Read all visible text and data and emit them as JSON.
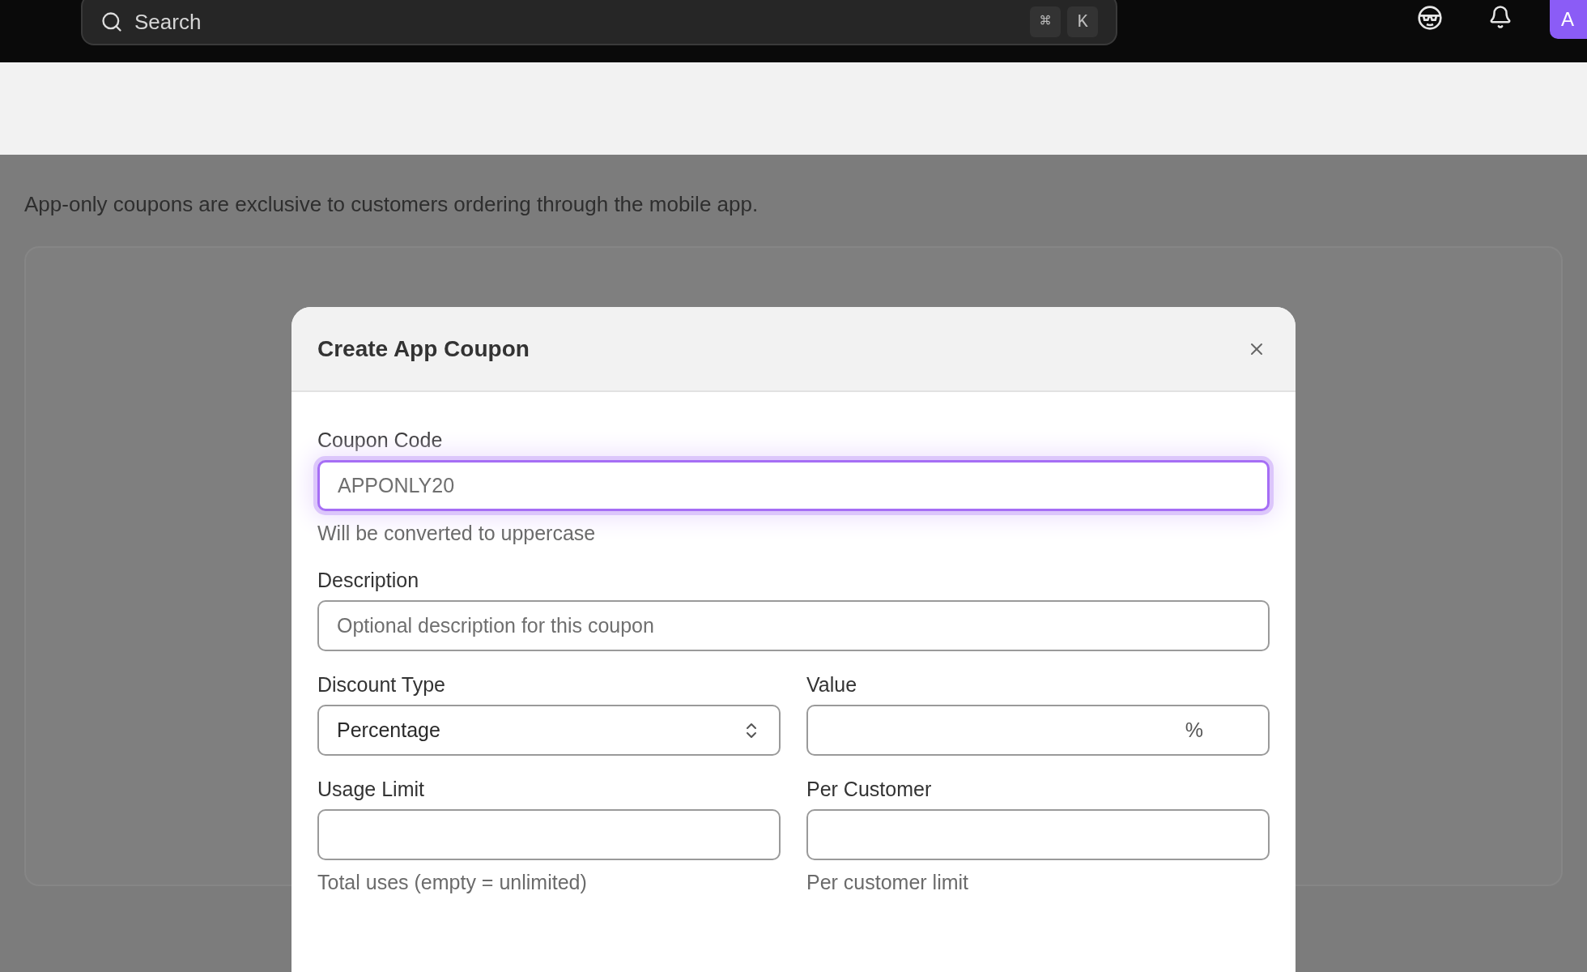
{
  "topbar": {
    "search": {
      "placeholder": "Search",
      "shortcut": [
        "⌘",
        "K"
      ]
    },
    "avatar": "A"
  },
  "page": {
    "description": "App-only coupons are exclusive to customers ordering through the mobile app."
  },
  "dialog": {
    "title": "Create App Coupon",
    "rows": [
      [
        {
          "kind": "text",
          "label": "Coupon Code",
          "placeholder": "APPONLY20",
          "focused": true,
          "hint": "Will be converted to uppercase"
        }
      ],
      [
        {
          "kind": "text",
          "label": "Description",
          "placeholder": "Optional description for this coupon",
          "focused": false
        }
      ],
      [
        {
          "kind": "select",
          "label": "Discount Type",
          "value": "Percentage",
          "focused": false
        },
        {
          "kind": "suffix",
          "label": "Value",
          "suffix": "%",
          "focused": false
        }
      ],
      [
        {
          "kind": "text",
          "label": "Usage Limit",
          "focused": false,
          "hint": "Total uses (empty = unlimited)"
        },
        {
          "kind": "text",
          "label": "Per Customer",
          "focused": false,
          "hint": "Per customer limit"
        }
      ]
    ]
  }
}
